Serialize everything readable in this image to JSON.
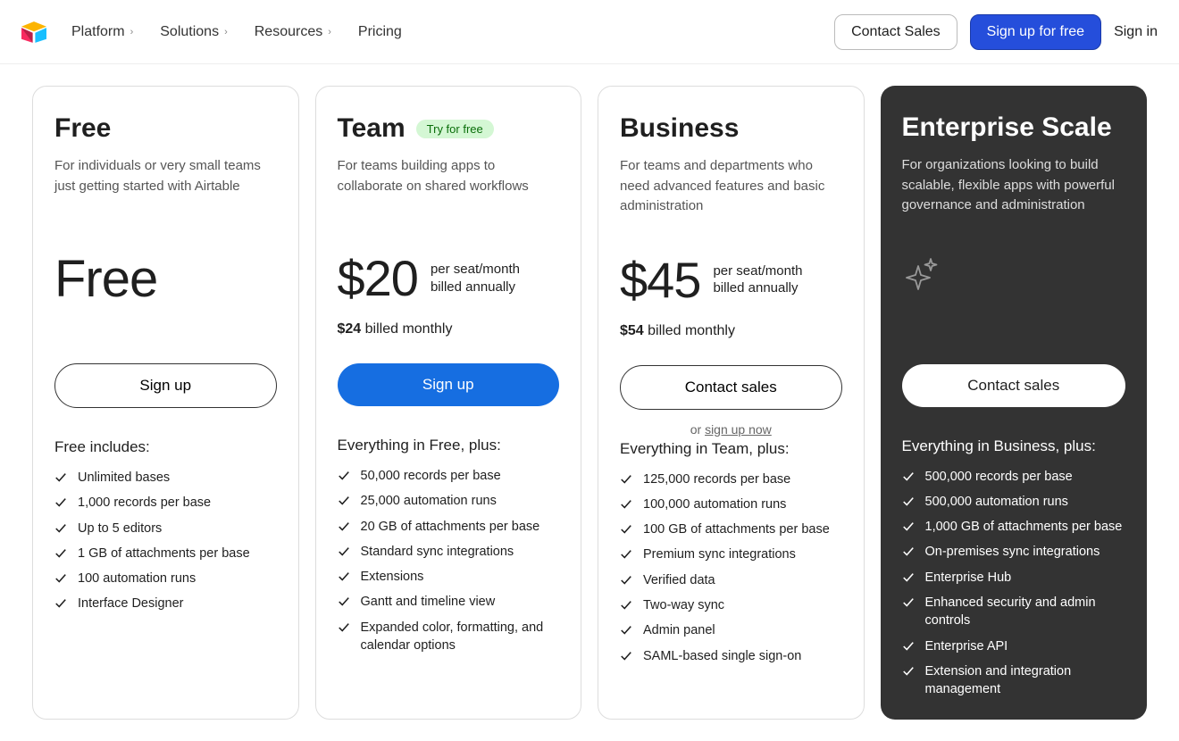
{
  "nav": {
    "items": [
      "Platform",
      "Solutions",
      "Resources",
      "Pricing"
    ]
  },
  "header": {
    "contact": "Contact Sales",
    "signup": "Sign up for free",
    "signin": "Sign in"
  },
  "plans": [
    {
      "name": "Free",
      "desc": "For individuals or very small teams just getting started with Airtable",
      "price": "Free",
      "cta": "Sign up",
      "feat_head": "Free includes:",
      "features": [
        "Unlimited bases",
        "1,000 records per base",
        "Up to 5 editors",
        "1 GB of attachments per base",
        "100 automation runs",
        "Interface Designer"
      ]
    },
    {
      "name": "Team",
      "badge": "Try for free",
      "desc": "For teams building apps to collaborate on shared workflows",
      "price": "$20",
      "price_unit1": "per seat/month",
      "price_unit2": "billed annually",
      "monthly_price": "$24",
      "monthly_suffix": " billed monthly",
      "cta": "Sign up",
      "feat_head": "Everything in Free, plus:",
      "features": [
        "50,000 records per base",
        "25,000 automation runs",
        "20 GB of attachments per base",
        "Standard sync integrations",
        "Extensions",
        "Gantt and timeline view",
        "Expanded color, formatting, and calendar options"
      ]
    },
    {
      "name": "Business",
      "desc": "For teams and departments who need advanced features and basic administration",
      "price": "$45",
      "price_unit1": "per seat/month",
      "price_unit2": "billed annually",
      "monthly_price": "$54",
      "monthly_suffix": " billed monthly",
      "cta": "Contact sales",
      "alt_prefix": "or ",
      "alt_link": "sign up now",
      "feat_head": "Everything in Team, plus:",
      "features": [
        "125,000 records per base",
        "100,000 automation runs",
        "100 GB of attachments per base",
        "Premium sync integrations",
        "Verified data",
        "Two-way sync",
        "Admin panel",
        "SAML-based single sign-on"
      ]
    },
    {
      "name": "Enterprise Scale",
      "desc": "For organizations looking to build scalable, flexible apps with powerful governance and administration",
      "cta": "Contact sales",
      "feat_head": "Everything in Business, plus:",
      "features": [
        "500,000 records per base",
        "500,000 automation runs",
        "1,000 GB of attachments per base",
        "On-premises sync integrations",
        "Enterprise Hub",
        "Enhanced security and admin controls",
        "Enterprise API",
        "Extension and integration management"
      ]
    }
  ]
}
